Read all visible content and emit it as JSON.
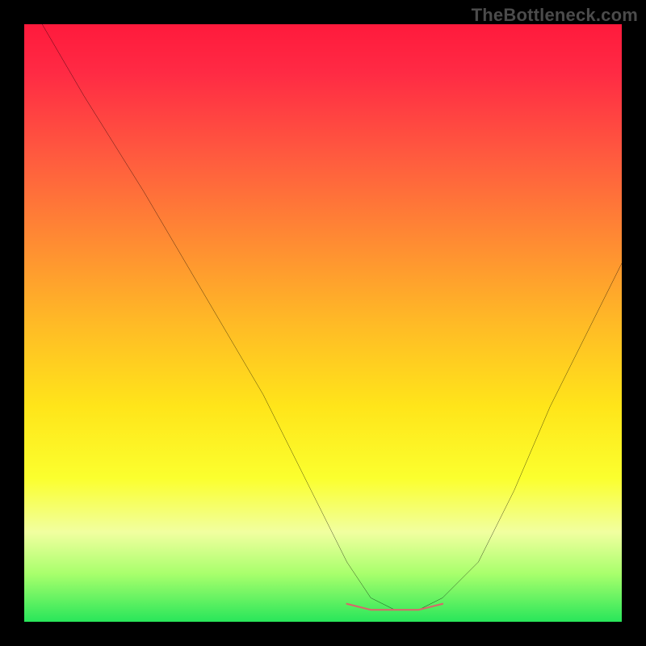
{
  "watermark": "TheBottleneck.com",
  "chart_data": {
    "type": "line",
    "title": "",
    "xlabel": "",
    "ylabel": "",
    "xlim": [
      0,
      100
    ],
    "ylim": [
      0,
      100
    ],
    "grid": false,
    "legend": false,
    "series": [
      {
        "name": "curve",
        "color": "#000000",
        "x": [
          3,
          10,
          20,
          30,
          40,
          48,
          54,
          58,
          62,
          66,
          70,
          76,
          82,
          88,
          94,
          100
        ],
        "y": [
          100,
          88,
          72,
          55,
          38,
          22,
          10,
          4,
          2,
          2,
          4,
          10,
          22,
          36,
          48,
          60
        ]
      }
    ],
    "highlight_band": {
      "name": "optimal-band",
      "color": "#d46a6a",
      "x": [
        54,
        58,
        62,
        66,
        70
      ],
      "y": [
        3,
        2,
        2,
        2,
        3
      ]
    },
    "background_gradient": {
      "top_color": "#ff1a3c",
      "mid_color": "#ffe51a",
      "bottom_color": "#28e65a"
    }
  }
}
